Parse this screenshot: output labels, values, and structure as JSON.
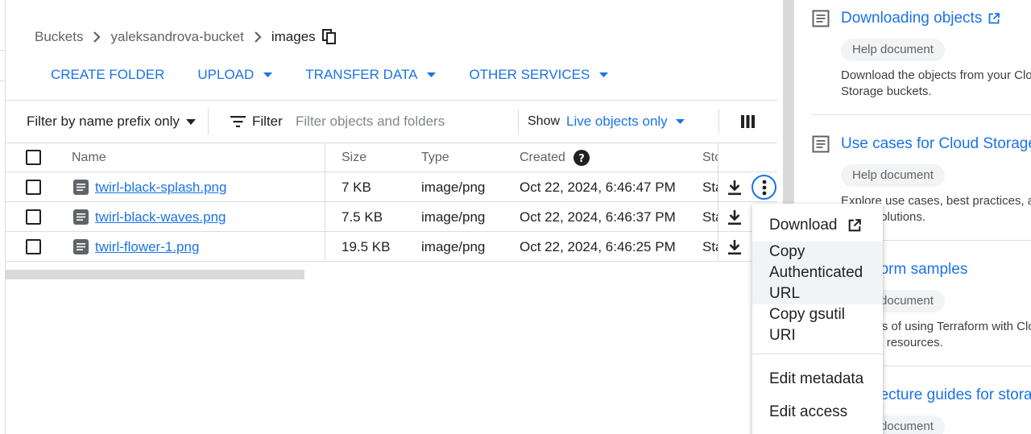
{
  "breadcrumb": {
    "items": [
      "Buckets",
      "yaleksandrova-bucket",
      "images"
    ]
  },
  "actions": {
    "create_folder": "CREATE FOLDER",
    "upload": "UPLOAD",
    "transfer_data": "TRANSFER DATA",
    "other_services": "OTHER SERVICES"
  },
  "filter_bar": {
    "mode": "Filter by name prefix only",
    "filter_label": "Filter",
    "placeholder": "Filter objects and folders",
    "show_label": "Show",
    "show_value": "Live objects only"
  },
  "table": {
    "columns": [
      "Name",
      "Size",
      "Type",
      "Created",
      "Sto"
    ],
    "rows": [
      {
        "name": "twirl-black-splash.png",
        "size": "7 KB",
        "type": "image/png",
        "created": "Oct 22, 2024, 6:46:47 PM",
        "storage": "Sta"
      },
      {
        "name": "twirl-black-waves.png",
        "size": "7.5 KB",
        "type": "image/png",
        "created": "Oct 22, 2024, 6:46:37 PM",
        "storage": "Sta"
      },
      {
        "name": "twirl-flower-1.png",
        "size": "19.5 KB",
        "type": "image/png",
        "created": "Oct 22, 2024, 6:46:25 PM",
        "storage": "Sta"
      }
    ]
  },
  "menu": {
    "items": [
      "Download",
      "Copy Authenticated URL",
      "Copy gsutil URI",
      "Edit metadata",
      "Edit access"
    ]
  },
  "side_panel": {
    "cards": [
      {
        "title": "Downloading objects",
        "chip": "Help document",
        "desc": [
          "Download the objects from your Cloud",
          "Storage buckets."
        ]
      },
      {
        "title": "Use cases for Cloud Storage",
        "chip": "Help document",
        "desc": [
          "Explore use cases, best practices, and",
          "ready solutions."
        ]
      },
      {
        "title": "Terraform samples",
        "chip": "Help document",
        "desc": [
          "Samples of using Terraform with Cloud",
          "Storage resources."
        ]
      },
      {
        "title": "Architecture guides for storage",
        "chip": "Help document",
        "desc": []
      }
    ]
  },
  "colors": {
    "accent": "#1a73e8",
    "text": "#202124",
    "muted": "#5f6368",
    "divider": "#dadce0"
  }
}
